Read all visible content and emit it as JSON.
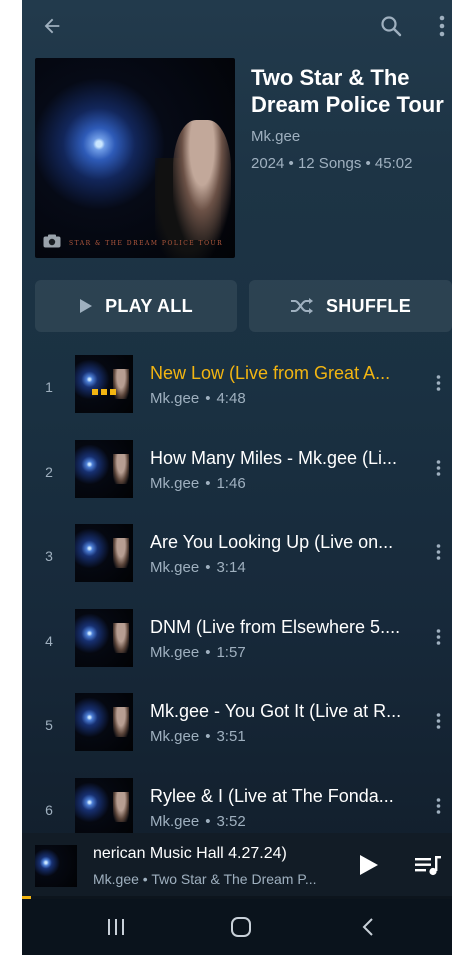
{
  "colors": {
    "accent": "#f2b512",
    "background_top": "#223a4c",
    "background_bottom": "#101b27",
    "secondary_text": "#9fb0bf"
  },
  "topbar": {
    "back_icon": "arrow-left-icon",
    "search_icon": "search-icon",
    "more_icon": "more-vertical-icon"
  },
  "album": {
    "title": "Two Star & The Dream Police Tour",
    "artist": "Mk.gee",
    "meta": "2024 • 12 Songs • 45:02",
    "cover_caption": "STAR & THE DREAM POLICE TOUR"
  },
  "actions": {
    "play_all": "PLAY ALL",
    "shuffle": "SHUFFLE"
  },
  "tracks": [
    {
      "number": "1",
      "title": "New Low (Live from Great A...",
      "artist": "Mk.gee",
      "duration": "4:48",
      "playing": true
    },
    {
      "number": "2",
      "title": "How Many Miles - Mk.gee (Li...",
      "artist": "Mk.gee",
      "duration": "1:46",
      "playing": false
    },
    {
      "number": "3",
      "title": "Are You Looking Up (Live on...",
      "artist": "Mk.gee",
      "duration": "3:14",
      "playing": false
    },
    {
      "number": "4",
      "title": "DNM (Live from Elsewhere 5....",
      "artist": "Mk.gee",
      "duration": "1:57",
      "playing": false
    },
    {
      "number": "5",
      "title": "Mk.gee - You Got It (Live at R...",
      "artist": "Mk.gee",
      "duration": "3:51",
      "playing": false
    },
    {
      "number": "6",
      "title": "Rylee & I (Live at The Fonda...",
      "artist": "Mk.gee",
      "duration": "3:52",
      "playing": false
    }
  ],
  "separator": "•",
  "mini_player": {
    "title": "nerican Music Hall 4.27.24)",
    "subtitle": "Mk.gee • Two Star & The Dream P...",
    "progress": 0.02
  }
}
